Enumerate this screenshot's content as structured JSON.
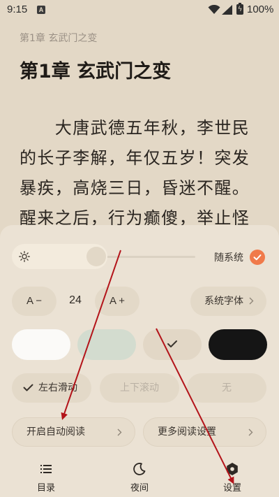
{
  "status": {
    "time": "9:15",
    "notif": "A",
    "battery": "100%"
  },
  "reader": {
    "header_chapter": "第1章 玄武门之变",
    "title": "第1章 玄武门之变",
    "lines": [
      "　　大唐武德五年秋，李世民",
      "的长子李解，年仅五岁！突发",
      "暴疾，高烧三日，昏迷不醒。",
      "醒来之后，行为癫傻，举止怪"
    ]
  },
  "settings": {
    "brightness": {
      "level": 0.52,
      "follow_system_label": "随系统",
      "follow_system_checked": true
    },
    "font": {
      "decrease_label": "A −",
      "size": "24",
      "increase_label": "A +",
      "face_label": "系统字体"
    },
    "themes": [
      {
        "name": "white",
        "color": "#fbfaf8"
      },
      {
        "name": "green",
        "color": "#d3dccf"
      },
      {
        "name": "beige",
        "color": "#e2d7c6",
        "selected": true
      },
      {
        "name": "black",
        "color": "#151515"
      }
    ],
    "scroll_modes": [
      {
        "label": "左右滑动",
        "selected": true
      },
      {
        "label": "上下滚动",
        "selected": false
      },
      {
        "label": "无",
        "selected": false
      }
    ],
    "auto_read_label": "开启自动阅读",
    "more_settings_label": "更多阅读设置"
  },
  "bottom_tabs": [
    {
      "label": "目录",
      "icon": "list-icon"
    },
    {
      "label": "夜间",
      "icon": "moon-icon"
    },
    {
      "label": "设置",
      "icon": "gear-icon"
    }
  ],
  "colors": {
    "accent": "#f07a4a",
    "background": "#e3d8c6",
    "panel": "#ebe2d4",
    "annotation_arrow": "#b3141a"
  }
}
